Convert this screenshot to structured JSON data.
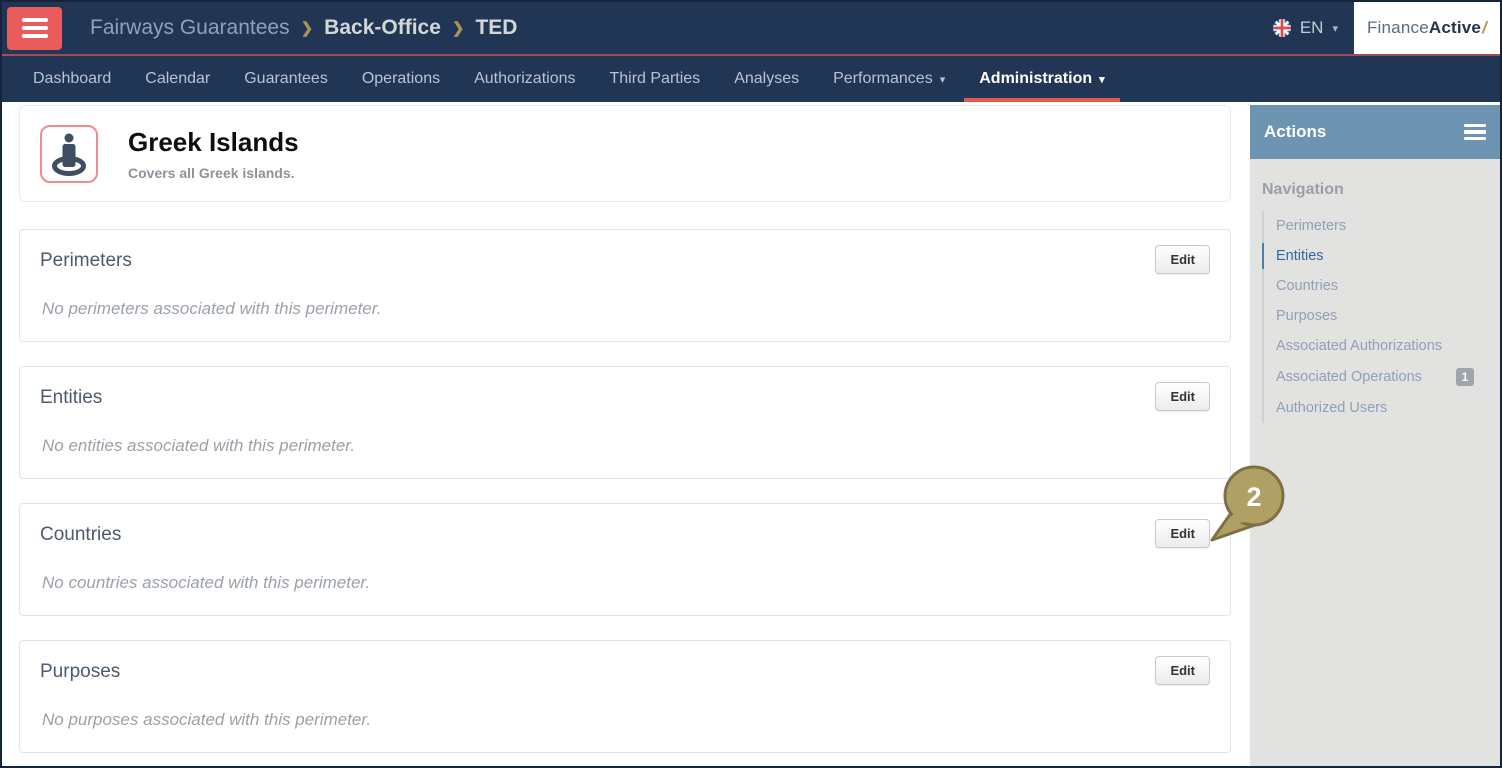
{
  "header": {
    "breadcrumb": {
      "root": "Fairways Guarantees",
      "sep": "❯",
      "level1": "Back-Office",
      "level2": "TED"
    },
    "language": {
      "code": "EN",
      "flag": "uk-flag-icon"
    },
    "logo": {
      "part1": "Finance",
      "part2": "Active",
      "slash": "/"
    }
  },
  "nav": {
    "items": [
      {
        "label": "Dashboard"
      },
      {
        "label": "Calendar"
      },
      {
        "label": "Guarantees"
      },
      {
        "label": "Operations"
      },
      {
        "label": "Authorizations"
      },
      {
        "label": "Third Parties"
      },
      {
        "label": "Analyses"
      },
      {
        "label": "Performances",
        "has_dropdown": true
      },
      {
        "label": "Administration",
        "has_dropdown": true,
        "active": true
      }
    ]
  },
  "page": {
    "title": "Greek Islands",
    "subtitle": "Covers all Greek islands.",
    "sections": [
      {
        "title": "Perimeters",
        "edit_label": "Edit",
        "empty_text": "No perimeters associated with this perimeter."
      },
      {
        "title": "Entities",
        "edit_label": "Edit",
        "empty_text": "No entities associated with this perimeter."
      },
      {
        "title": "Countries",
        "edit_label": "Edit",
        "empty_text": "No countries associated with this perimeter."
      },
      {
        "title": "Purposes",
        "edit_label": "Edit",
        "empty_text": "No purposes associated with this perimeter."
      }
    ]
  },
  "sidebar": {
    "actions_title": "Actions",
    "navigation_title": "Navigation",
    "items": [
      {
        "label": "Perimeters"
      },
      {
        "label": "Entities",
        "active": true
      },
      {
        "label": "Countries"
      },
      {
        "label": "Purposes"
      },
      {
        "label": "Associated Authorizations"
      },
      {
        "label": "Associated Operations",
        "badge": "1"
      },
      {
        "label": "Authorized Users"
      }
    ]
  },
  "annotation": {
    "label": "2"
  },
  "icons": {
    "chevron_down": "▾"
  },
  "colors": {
    "navy": "#213555",
    "red_accent": "#e25a52",
    "hamburger_red": "#e85c5c",
    "divider_red": "#a04a5a",
    "steel_blue": "#6d95b1",
    "sidebar_gray": "#e2e2e1",
    "active_link_blue": "#33679c",
    "callout_tan": "#b1a063",
    "callout_border": "#7e7045",
    "gold_slash": "#b29a55",
    "icon_border_pink": "#f28b8b"
  }
}
